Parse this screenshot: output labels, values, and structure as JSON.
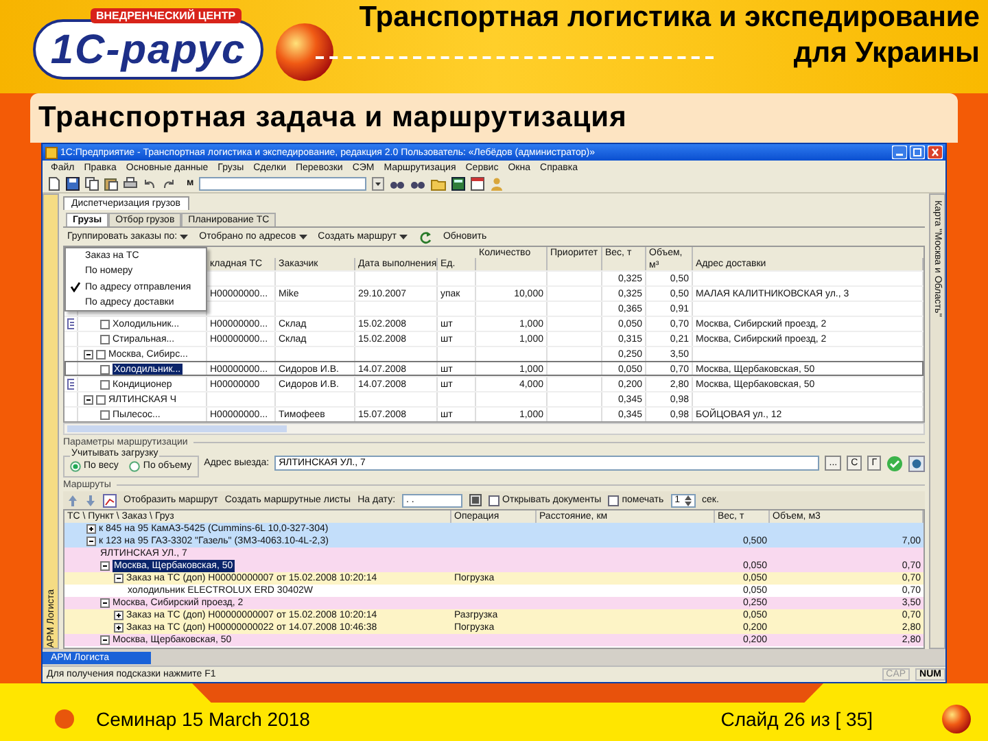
{
  "slide": {
    "logo": {
      "caption": "ВНЕДРЕНЧЕСКИЙ ЦЕНТР",
      "wordmark": "1С-рарус"
    },
    "title": "Транспортная логистика и экспедирование для Украины",
    "subtitle": "Транспортная задача и маршрутизация",
    "footer": {
      "seminar": "Семинар 15 March 2018",
      "slide_number": "Слайд 26 из [ 35]"
    }
  },
  "window": {
    "title": "1С:Предприятие - Транспортная логистика и экспедирование, редакция 2.0   Пользователь: «Лебёдов (администратор)»",
    "menu": [
      "Файл",
      "Правка",
      "Основные данные",
      "Грузы",
      "Сделки",
      "Перевозки",
      "СЭМ",
      "Маршрутизация",
      "Сервис",
      "Окна",
      "Справка"
    ],
    "toolbar_label": "м",
    "left_panel": "АРМ Логиста",
    "right_panel": "Карта \"Москва и Область\"",
    "document_tab": "Диспетчеризация грузов",
    "tabs": [
      {
        "label": "Грузы",
        "selected": true
      },
      {
        "label": "Отбор грузов",
        "selected": false
      },
      {
        "label": "Планирование ТС",
        "selected": false
      }
    ],
    "cargo": {
      "toolbar": [
        {
          "label": "Группировать заказы по:",
          "kind": "menu"
        },
        {
          "label": "Отобрано по адресов",
          "kind": "menu"
        },
        {
          "label": "Создать маршрут",
          "kind": "menu"
        },
        {
          "label": "Обновить",
          "kind": "refresh"
        }
      ],
      "group_menu": [
        {
          "label": "Заказ на ТС",
          "checked": false
        },
        {
          "label": "По номеру",
          "checked": false
        },
        {
          "label": "По адресу отправления",
          "checked": true
        },
        {
          "label": "По адресу доставки",
          "checked": false
        }
      ],
      "columns": [
        "кладная ТС",
        "Заказчик",
        "Дата выполнения",
        "Ед.",
        "Количество",
        "Приоритет",
        "Вес, т",
        "Объем, м³",
        "Адрес доставки"
      ],
      "rows": [
        {
          "selected": false,
          "weight": "0,325",
          "volume": "0,50",
          "children": [
            {
              "selected": false,
              "number": "Н00000000...",
              "customer": "Mike",
              "date": "29.10.2007",
              "unit": "упак",
              "quantity": "10,000",
              "weight": "0,325",
              "volume": "0,50",
              "address": "МАЛАЯ КАЛИТНИКОВСКАЯ ул., 3"
            }
          ]
        },
        {
          "selected": false,
          "weight": "0,365",
          "volume": "0,91",
          "children": [
            {
              "name": "Холодильник...",
              "selected": false,
              "flagged": true,
              "number": "Н00000000...",
              "customer": "Склад",
              "date": "15.02.2008",
              "unit": "шт",
              "quantity": "1,000",
              "weight": "0,050",
              "volume": "0,70",
              "address": "Москва, Сибирский проезд, 2"
            },
            {
              "name": "Стиральная...",
              "selected": false,
              "flagged": false,
              "number": "Н00000000...",
              "customer": "Склад",
              "date": "15.02.2008",
              "unit": "шт",
              "quantity": "1,000",
              "weight": "0,315",
              "volume": "0,21",
              "address": "Москва, Сибирский проезд, 2"
            }
          ]
        },
        {
          "name": "Москва, Сибирс...",
          "expanded": true,
          "selected": false,
          "weight": "0,250",
          "volume": "3,50",
          "children": [
            {
              "name": "Холодильник...",
              "selected": true,
              "flagged": false,
              "number": "Н00000000...",
              "customer": "Сидоров И.В.",
              "date": "14.07.2008",
              "unit": "шт",
              "quantity": "1,000",
              "weight": "0,050",
              "volume": "0,70",
              "address": "Москва, Щербаковская, 50"
            },
            {
              "name": "Кондиционер",
              "selected": false,
              "flagged": true,
              "number": "Н00000000",
              "customer": "Сидоров И.В.",
              "date": "14.07.2008",
              "unit": "шт",
              "quantity": "4,000",
              "weight": "0,200",
              "volume": "2,80",
              "address": "Москва, Щербаковская, 50"
            }
          ]
        },
        {
          "name": "ЯЛТИНСКАЯ Ч",
          "expanded": true,
          "selected": false,
          "weight": "0,345",
          "volume": "0,98",
          "children": [
            {
              "name": "Пылесос...",
              "selected": false,
              "flagged": false,
              "number": "Н00000000...",
              "customer": "Тимофеев",
              "date": "15.07.2008",
              "unit": "шт",
              "quantity": "1,000",
              "weight": "0,345",
              "volume": "0,98",
              "address": "БОЙЦОВАЯ ул., 12"
            }
          ]
        }
      ]
    },
    "params": {
      "title": "Параметры маршрутизации",
      "load_title": "Учитывать загрузку",
      "load_options": [
        {
          "label": "По весу",
          "selected": true
        },
        {
          "label": "По объему",
          "selected": false
        }
      ],
      "address_label": "Адрес выезда:",
      "address_value": "ЯЛТИНСКАЯ УЛ., 7",
      "buttons": [
        "...",
        "С",
        "Г"
      ]
    },
    "routes": {
      "title": "Маршруты",
      "show_route": "Отобразить маршрут",
      "create_sheets": "Создать маршрутные листы",
      "date_label": "На дату:",
      "date_value": ". .",
      "options": [
        {
          "label": "Открывать документы",
          "checked": false
        },
        {
          "label": "помечать",
          "checked": false
        }
      ],
      "count": "1",
      "count_unit": "сек.",
      "columns": [
        "ТС \\ Пункт \\ Заказ \\ Груз",
        "Операция",
        "Расстояние, км",
        "Вес, т",
        "Объем, м3"
      ],
      "rows": [
        {
          "kind": "vehicle",
          "name": "к 845 на 95 КамАЗ-5425 (Cummins-6L 10,0-327-304)",
          "expanded": false,
          "selected": false
        },
        {
          "kind": "vehicle",
          "name": "к 123 на 95 ГАЗ-3302 \"Газель\" (ЗМЗ-4063.10-4L-2,3)",
          "expanded": true,
          "selected": false,
          "weight": "0,500",
          "volume": "7,00",
          "children": [
            {
              "kind": "point",
              "name": "ЯЛТИНСКАЯ УЛ., 7",
              "selected": false
            },
            {
              "kind": "point",
              "name": "Москва, Щербаковская, 50",
              "expanded": true,
              "selected": true,
              "weight": "0,050",
              "volume": "0,70",
              "children": [
                {
                  "kind": "order",
                  "name": "Заказ на ТС (доп) Н00000000007 от 15.02.2008 10:20:14",
                  "operation": "Погрузка",
                  "expanded": true,
                  "selected": false,
                  "weight": "0,050",
                  "volume": "0,70",
                  "children": [
                    {
                      "kind": "cargo",
                      "name": "холодильник ELECTROLUX ERD 30402W",
                      "selected": false,
                      "weight": "0,050",
                      "volume": "0,70"
                    }
                  ]
                }
              ]
            },
            {
              "kind": "point",
              "name": "Москва, Сибирский проезд, 2",
              "expanded": true,
              "selected": false,
              "weight": "0,250",
              "volume": "3,50",
              "children": [
                {
                  "kind": "order",
                  "name": "Заказ на ТС (доп) Н00000000007 от 15.02.2008 10:20:14",
                  "operation": "Разгрузка",
                  "expanded": false,
                  "selected": false,
                  "weight": "0,050",
                  "volume": "0,70"
                },
                {
                  "kind": "order",
                  "name": "Заказ на ТС (доп) Н00000000022 от 14.07.2008 10:46:38",
                  "operation": "Погрузка",
                  "expanded": false,
                  "selected": false,
                  "weight": "0,200",
                  "volume": "2,80"
                }
              ]
            },
            {
              "kind": "point",
              "name": "Москва, Щербаковская, 50",
              "expanded": true,
              "selected": false,
              "weight": "0,200",
              "volume": "2,80"
            }
          ]
        }
      ]
    },
    "taskbar": "АРМ Логиста",
    "status": {
      "text": "Для получения подсказки нажмите F1",
      "indicators": [
        {
          "label": "CAP",
          "on": false
        },
        {
          "label": "NUM",
          "on": true
        }
      ]
    }
  }
}
